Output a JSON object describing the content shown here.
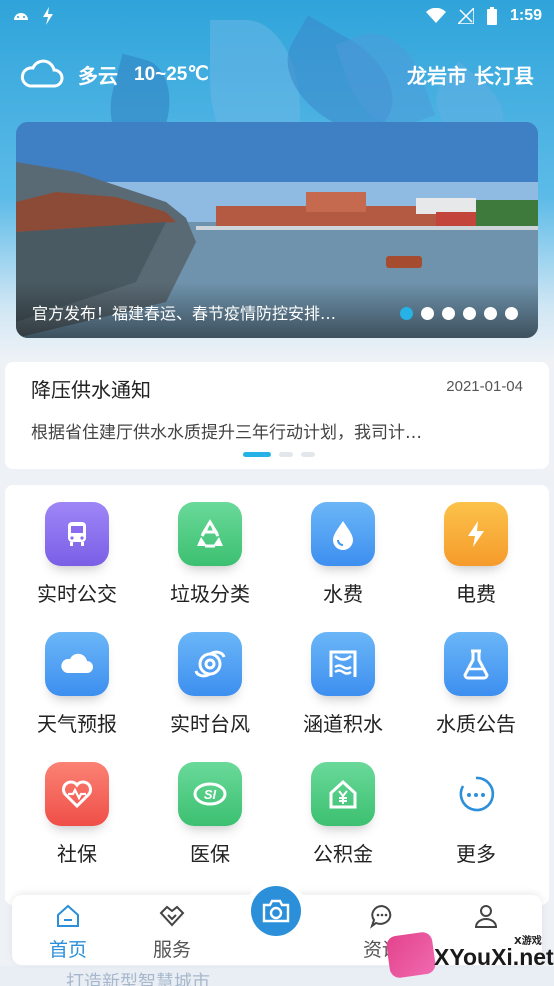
{
  "status_bar": {
    "time": "1:59"
  },
  "weather": {
    "condition": "多云",
    "temperature": "10~25℃",
    "icon": "cloud-icon"
  },
  "location": "龙岩市 长汀县",
  "banner": {
    "title": "官方发布！福建春运、春节疫情防控安排…",
    "dot_count": 6,
    "active_dot": 0
  },
  "notice": {
    "title": "降压供水通知",
    "date": "2021-01-04",
    "body": "根据省住建厅供水水质提升三年行动计划，我司计…"
  },
  "services": [
    {
      "label": "实时公交",
      "icon": "bus-icon",
      "color": "#8b6cf0"
    },
    {
      "label": "垃圾分类",
      "icon": "recycle-icon",
      "color": "#43c97a"
    },
    {
      "label": "水费",
      "icon": "water-drop-icon",
      "color": "#3f9bf0"
    },
    {
      "label": "电费",
      "icon": "lightning-icon",
      "color": "#f7a531"
    },
    {
      "label": "天气预报",
      "icon": "cloud-icon",
      "color": "#3f9bf0"
    },
    {
      "label": "实时台风",
      "icon": "typhoon-icon",
      "color": "#3f9bf0"
    },
    {
      "label": "涵道积水",
      "icon": "flood-icon",
      "color": "#3f9bf0"
    },
    {
      "label": "水质公告",
      "icon": "flask-icon",
      "color": "#3f9bf0"
    },
    {
      "label": "社保",
      "icon": "heart-icon",
      "color": "#f05a52"
    },
    {
      "label": "医保",
      "icon": "medical-insurance-icon",
      "color": "#43c97a"
    },
    {
      "label": "公积金",
      "icon": "housing-fund-icon",
      "color": "#43c97a"
    },
    {
      "label": "更多",
      "icon": "more-icon",
      "color": "#2b90d9"
    }
  ],
  "bottom_nav": {
    "home": "首页",
    "service": "服务",
    "info": "资讯",
    "camera_icon": "camera-icon"
  },
  "footer_text": "打造新型智慧城市",
  "watermark": {
    "small": "X游戏",
    "text": "XYouXi.net"
  }
}
